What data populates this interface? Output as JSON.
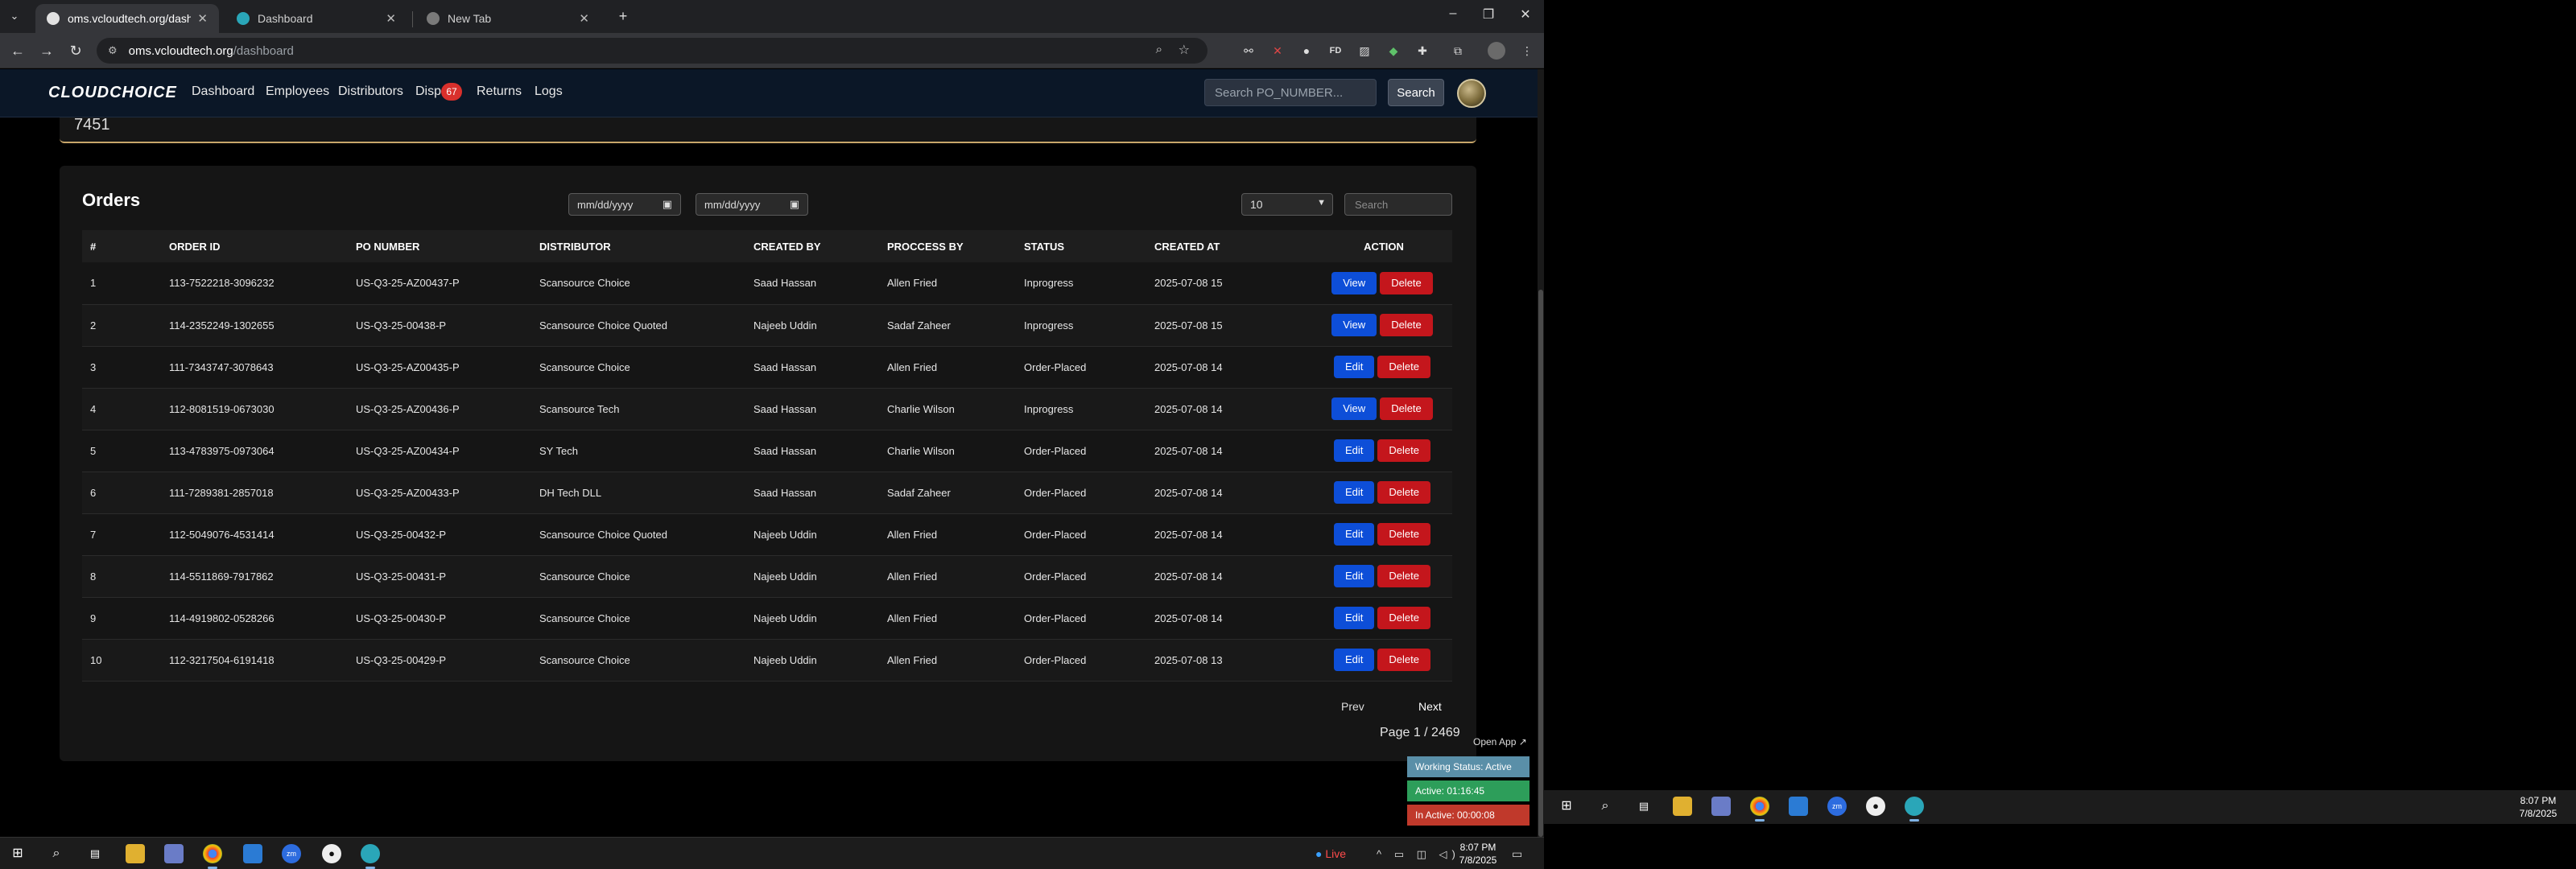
{
  "browser": {
    "tabs": [
      {
        "title": "oms.vcloudtech.org/dashboard",
        "active": true
      },
      {
        "title": "Dashboard",
        "active": false
      },
      {
        "title": "New Tab",
        "active": false
      }
    ],
    "new_tab_label": "+",
    "url_host": "oms.vcloudtech.org",
    "url_path": "/dashboard"
  },
  "app": {
    "logo": "CLOUDCHOICE",
    "nav": [
      "Dashboard",
      "Employees",
      "Distributors",
      "Dispu",
      "Returns",
      "Logs"
    ],
    "dispute_badge": "67",
    "po_search_placeholder": "Search PO_NUMBER...",
    "search_label": "Search"
  },
  "top_card": {
    "value": "7451"
  },
  "orders": {
    "title": "Orders",
    "date_from_placeholder": "mm/dd/yyyy",
    "date_to_placeholder": "mm/dd/yyyy",
    "page_size": "10",
    "search_placeholder": "Search",
    "columns": [
      "#",
      "ORDER ID",
      "PO NUMBER",
      "DISTRIBUTOR",
      "CREATED BY",
      "PROCCESS BY",
      "STATUS",
      "CREATED AT",
      "ACTION"
    ],
    "rows": [
      {
        "n": "1",
        "order_id": "113-7522218-3096232",
        "po": "US-Q3-25-AZ00437-P",
        "distributor": "Scansource Choice",
        "created_by": "Saad Hassan",
        "process_by": "Allen Fried",
        "status": "Inprogress",
        "created_at": "2025-07-08 15",
        "primary": "View",
        "secondary": "Delete"
      },
      {
        "n": "2",
        "order_id": "114-2352249-1302655",
        "po": "US-Q3-25-00438-P",
        "distributor": "Scansource Choice Quoted",
        "created_by": "Najeeb Uddin",
        "process_by": "Sadaf Zaheer",
        "status": "Inprogress",
        "created_at": "2025-07-08 15",
        "primary": "View",
        "secondary": "Delete"
      },
      {
        "n": "3",
        "order_id": "111-7343747-3078643",
        "po": "US-Q3-25-AZ00435-P",
        "distributor": "Scansource Choice",
        "created_by": "Saad Hassan",
        "process_by": "Allen Fried",
        "status": "Order-Placed",
        "created_at": "2025-07-08 14",
        "primary": "Edit",
        "secondary": "Delete"
      },
      {
        "n": "4",
        "order_id": "112-8081519-0673030",
        "po": "US-Q3-25-AZ00436-P",
        "distributor": "Scansource Tech",
        "created_by": "Saad Hassan",
        "process_by": "Charlie Wilson",
        "status": "Inprogress",
        "created_at": "2025-07-08 14",
        "primary": "View",
        "secondary": "Delete"
      },
      {
        "n": "5",
        "order_id": "113-4783975-0973064",
        "po": "US-Q3-25-AZ00434-P",
        "distributor": "SY Tech",
        "created_by": "Saad Hassan",
        "process_by": "Charlie Wilson",
        "status": "Order-Placed",
        "created_at": "2025-07-08 14",
        "primary": "Edit",
        "secondary": "Delete"
      },
      {
        "n": "6",
        "order_id": "111-7289381-2857018",
        "po": "US-Q3-25-AZ00433-P",
        "distributor": "DH Tech DLL",
        "created_by": "Saad Hassan",
        "process_by": "Sadaf Zaheer",
        "status": "Order-Placed",
        "created_at": "2025-07-08 14",
        "primary": "Edit",
        "secondary": "Delete"
      },
      {
        "n": "7",
        "order_id": "112-5049076-4531414",
        "po": "US-Q3-25-00432-P",
        "distributor": "Scansource Choice Quoted",
        "created_by": "Najeeb Uddin",
        "process_by": "Allen Fried",
        "status": "Order-Placed",
        "created_at": "2025-07-08 14",
        "primary": "Edit",
        "secondary": "Delete"
      },
      {
        "n": "8",
        "order_id": "114-5511869-7917862",
        "po": "US-Q3-25-00431-P",
        "distributor": "Scansource Choice",
        "created_by": "Najeeb Uddin",
        "process_by": "Allen Fried",
        "status": "Order-Placed",
        "created_at": "2025-07-08 14",
        "primary": "Edit",
        "secondary": "Delete"
      },
      {
        "n": "9",
        "order_id": "114-4919802-0528266",
        "po": "US-Q3-25-00430-P",
        "distributor": "Scansource Choice",
        "created_by": "Najeeb Uddin",
        "process_by": "Allen Fried",
        "status": "Order-Placed",
        "created_at": "2025-07-08 14",
        "primary": "Edit",
        "secondary": "Delete"
      },
      {
        "n": "10",
        "order_id": "112-3217504-6191418",
        "po": "US-Q3-25-00429-P",
        "distributor": "Scansource Choice",
        "created_by": "Najeeb Uddin",
        "process_by": "Allen Fried",
        "status": "Order-Placed",
        "created_at": "2025-07-08 13",
        "primary": "Edit",
        "secondary": "Delete"
      }
    ],
    "prev_label": "Prev",
    "next_label": "Next",
    "page_info": "Page 1 / 2469"
  },
  "tracker": {
    "open_app": "Open App ↗",
    "status": "Working Status: Active",
    "active": "Active: 01:16:45",
    "inactive": "In Active: 00:00:08"
  },
  "taskbar": {
    "live": "Live",
    "time": "8:07 PM",
    "date": "7/8/2025"
  },
  "colors": {
    "accent_blue": "#0d4ed8",
    "danger_red": "#c4161c",
    "nav_bg": "#0b1727",
    "badge_red": "#d9302c"
  }
}
